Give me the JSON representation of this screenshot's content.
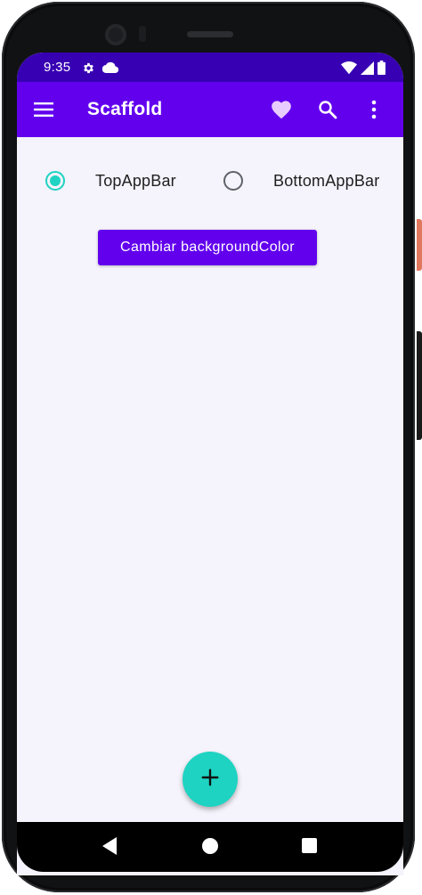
{
  "status_bar": {
    "time": "9:35",
    "icons": [
      "settings-gear-icon",
      "cloud-icon",
      "wifi-icon",
      "cellular-signal-icon",
      "battery-icon"
    ]
  },
  "app_bar": {
    "title": "Scaffold",
    "nav_icon": "menu-icon",
    "actions": [
      "favorite-heart-icon",
      "search-icon",
      "more-vert-icon"
    ]
  },
  "radio_group": {
    "options": [
      {
        "label": "TopAppBar",
        "selected": true
      },
      {
        "label": "BottomAppBar",
        "selected": false
      }
    ]
  },
  "main": {
    "button_label": "Cambiar backgroundColor"
  },
  "fab": {
    "icon": "add-icon"
  },
  "navigation_bar": {
    "icons": [
      "back-triangle-icon",
      "home-circle-icon",
      "recents-square-icon"
    ]
  },
  "colors": {
    "status_bar": "#3700b3",
    "primary": "#6200ee",
    "secondary": "#1ed3c2",
    "background": "#f5f3fb",
    "on_primary": "#ffffff"
  }
}
